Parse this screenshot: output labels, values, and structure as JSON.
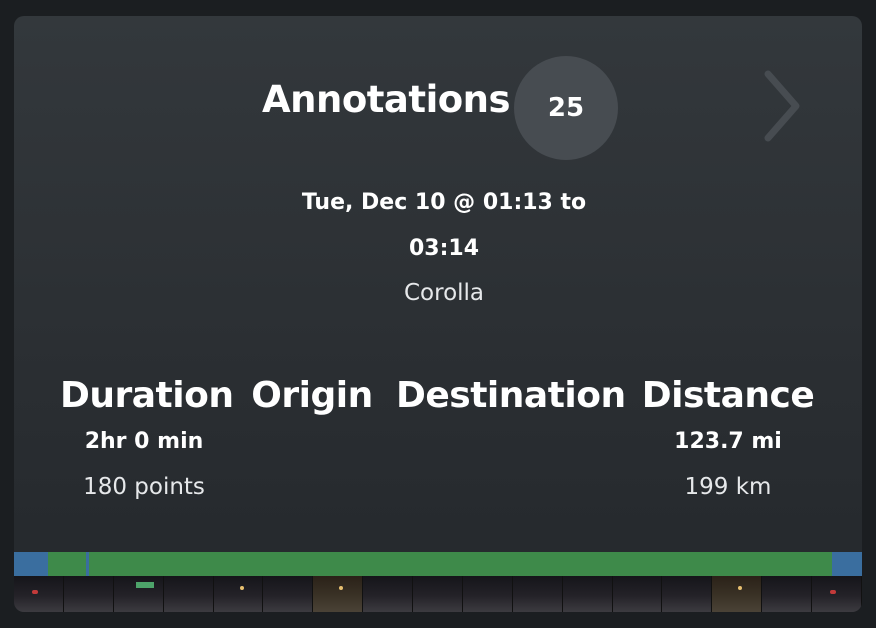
{
  "header": {
    "title": "Annotations",
    "count": "25",
    "next_icon": "chevron-right-icon"
  },
  "drive": {
    "date_range_line1": "Tue, Dec 10 @ 01:13 to",
    "date_range_line2": "03:14",
    "vehicle": "Corolla"
  },
  "stats": {
    "duration": {
      "label": "Duration",
      "value": "2hr 0 min",
      "sub": "180 points"
    },
    "origin": {
      "label": "Origin",
      "value": "",
      "sub": ""
    },
    "destination": {
      "label": "Destination",
      "value": "",
      "sub": ""
    },
    "distance": {
      "label": "Distance",
      "value": "123.7 mi",
      "sub": "199 km"
    }
  },
  "colors": {
    "card_background": "#2b2f33",
    "badge_background": "#474c51",
    "timeline_blue": "#3a6e9f",
    "timeline_green": "#3e8a4a"
  }
}
